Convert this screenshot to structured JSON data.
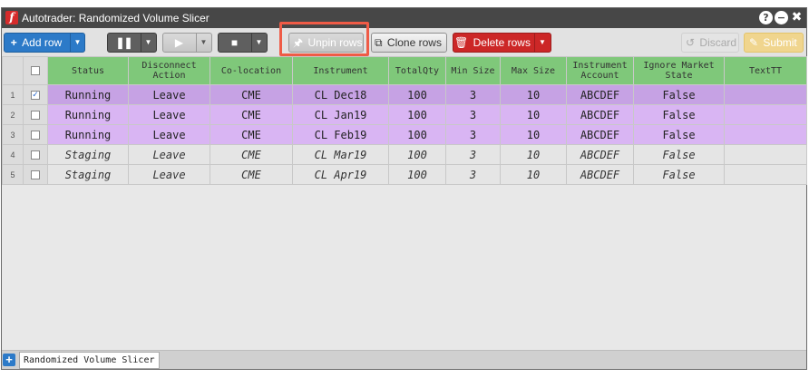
{
  "window": {
    "title": "Autotrader: Randomized Volume Slicer",
    "title_icons": [
      "help-icon",
      "minimize-icon",
      "close-icon"
    ]
  },
  "toolbar": {
    "add_row_label": "Add row",
    "unpin_label": "Unpin rows",
    "clone_label": "Clone rows",
    "delete_label": "Delete rows",
    "discard_label": "Discard",
    "submit_label": "Submit"
  },
  "columns": [
    "Status",
    "Disconnect Action",
    "Co-location",
    "Instrument",
    "TotalQty",
    "Min Size",
    "Max Size",
    "Instrument Account",
    "Ignore Market State",
    "TextTT"
  ],
  "rows": [
    {
      "num": "1",
      "checked": true,
      "state": "running",
      "cells": [
        "Running",
        "Leave",
        "CME",
        "CL Dec18",
        "100",
        "3",
        "10",
        "ABCDEF",
        "False",
        ""
      ]
    },
    {
      "num": "2",
      "checked": false,
      "state": "running",
      "cells": [
        "Running",
        "Leave",
        "CME",
        "CL Jan19",
        "100",
        "3",
        "10",
        "ABCDEF",
        "False",
        ""
      ]
    },
    {
      "num": "3",
      "checked": false,
      "state": "running",
      "cells": [
        "Running",
        "Leave",
        "CME",
        "CL Feb19",
        "100",
        "3",
        "10",
        "ABCDEF",
        "False",
        ""
      ]
    },
    {
      "num": "4",
      "checked": false,
      "state": "staging",
      "cells": [
        "Staging",
        "Leave",
        "CME",
        "CL Mar19",
        "100",
        "3",
        "10",
        "ABCDEF",
        "False",
        ""
      ]
    },
    {
      "num": "5",
      "checked": false,
      "state": "staging",
      "cells": [
        "Staging",
        "Leave",
        "CME",
        "CL Apr19",
        "100",
        "3",
        "10",
        "ABCDEF",
        "False",
        ""
      ]
    }
  ],
  "tabs": {
    "active_tab": "Randomized Volume Slicer"
  },
  "colors": {
    "running_row": "#d9b5f3",
    "selected_running_row": "#c6a2e4",
    "staging_row": "#e5e5e5",
    "header": "#7fc87a",
    "highlight": "#ef5b46"
  }
}
